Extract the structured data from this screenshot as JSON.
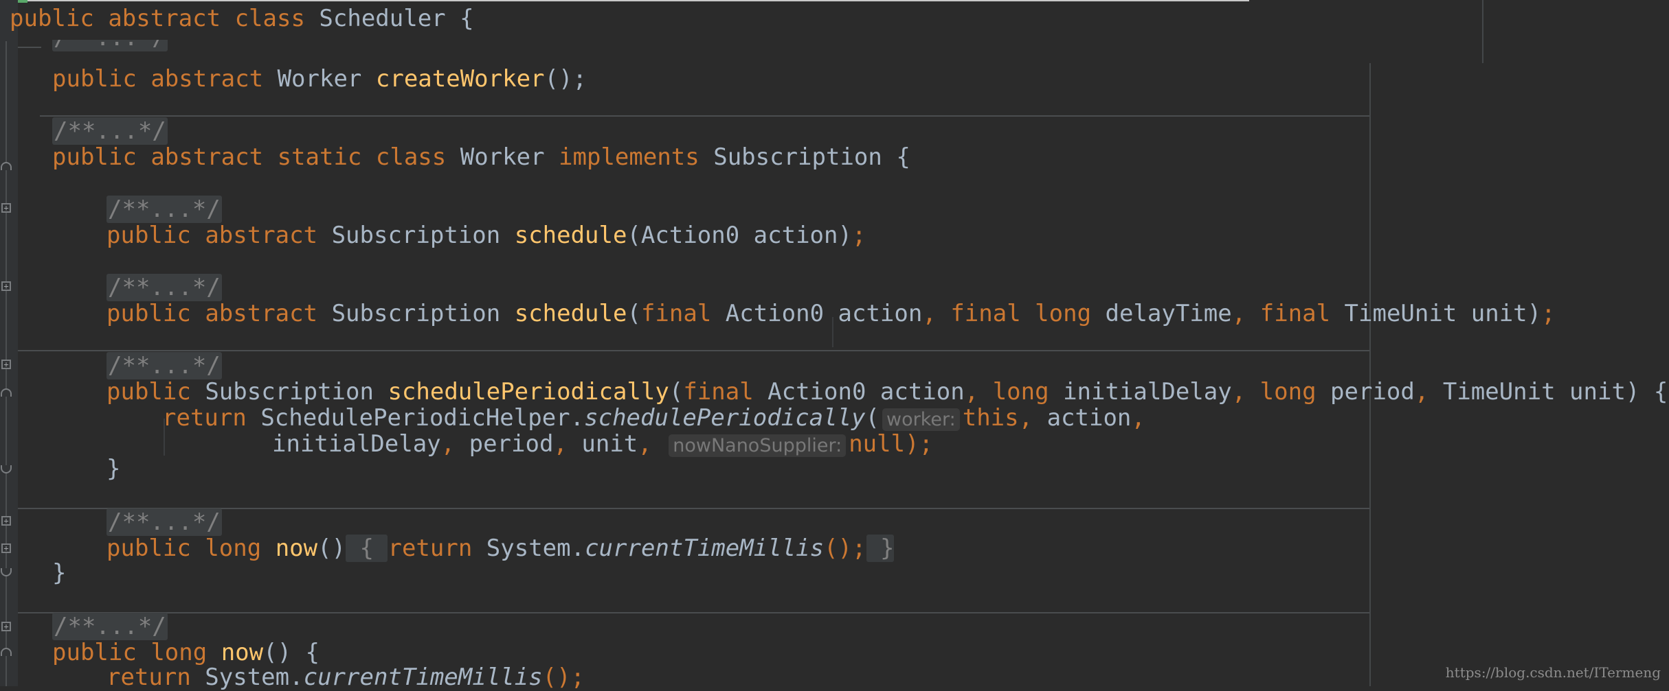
{
  "editor": {
    "class_decl": {
      "kw1": "public",
      "kw2": "abstract",
      "kw3": "class",
      "name": "Scheduler",
      "brace": " {"
    },
    "folded_doc": "/**...*/",
    "create_worker": {
      "kw1": "public",
      "kw2": "abstract",
      "type": "Worker",
      "method": "createWorker",
      "tail": "();"
    },
    "worker_class": {
      "kw1": "public",
      "kw2": "abstract",
      "kw3": "static",
      "kw4": "class",
      "name": "Worker",
      "implements": "implements",
      "iface": "Subscription",
      "brace": " {"
    },
    "schedule1": {
      "kw1": "public",
      "kw2": "abstract",
      "type": "Subscription",
      "method": "schedule",
      "params": "(Action0 action)",
      "semi": ";"
    },
    "schedule2": {
      "kw1": "public",
      "kw2": "abstract",
      "type": "Subscription",
      "method": "schedule",
      "p1": "(",
      "final1": "final",
      "p2": " Action0 action",
      "c1": ",",
      "final2": "final",
      "long": "long",
      "p3": " delayTime",
      "c2": ",",
      "final3": "final",
      "p4": " TimeUnit unit)",
      "semi": ";"
    },
    "periodic": {
      "kw1": "public",
      "type": "Subscription",
      "method": "schedulePeriodically",
      "p1": "(",
      "final": "final",
      "p2": " Action0 action",
      "c1": ",",
      "long1": "long",
      "p3": " initialDelay",
      "c2": ",",
      "long2": "long",
      "p4": " period",
      "c3": ",",
      "p5": " TimeUnit unit) {"
    },
    "periodic_return": {
      "ret": "return",
      "helper": "SchedulePeriodicHelper.",
      "call": "schedulePeriodically",
      "paren": "(",
      "hint_worker": "worker:",
      "this": "this",
      "c1": ",",
      "rest": " action",
      "c2": ","
    },
    "periodic_cont": {
      "a1": "initialDelay",
      "c1": ",",
      "a2": " period",
      "c2": ",",
      "a3": " unit",
      "c3": ",",
      "hint_nano": "nowNanoSupplier:",
      "null": "null",
      "tail": ");"
    },
    "close_brace": "}",
    "worker_now": {
      "kw1": "public",
      "long": "long",
      "method": "now",
      "paren": "()",
      "fb_open": " { ",
      "ret": "return",
      "sys": " System.",
      "call": "currentTimeMillis",
      "tail": "();",
      "fb_close": " }"
    },
    "now_decl": {
      "kw1": "public",
      "long": "long",
      "method": "now",
      "tail": "() {"
    },
    "now_return": {
      "ret": "return",
      "sys": " System.",
      "call": "currentTimeMillis",
      "tail": "();"
    }
  },
  "watermark": "https://blog.csdn.net/ITermeng"
}
